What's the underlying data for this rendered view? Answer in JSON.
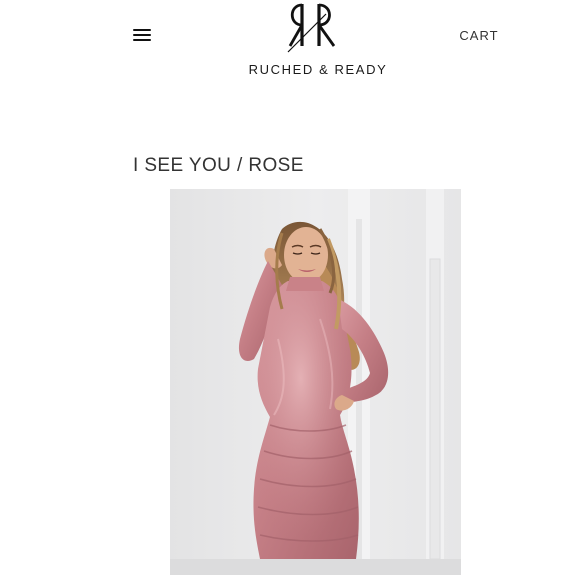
{
  "header": {
    "menu_icon": "hamburger-menu-icon",
    "logo_icon": "rr-monogram-logo",
    "brand_name": "RUCHED & READY",
    "cart_label": "CART"
  },
  "product": {
    "title": "I SEE YOU / ROSE",
    "image": {
      "subject": "model wearing rose pink velvet long-sleeve mini dress",
      "dress_color": "#c98288",
      "background_color": "#e9e9ea"
    }
  },
  "colors": {
    "text": "#222222",
    "background": "#ffffff"
  }
}
